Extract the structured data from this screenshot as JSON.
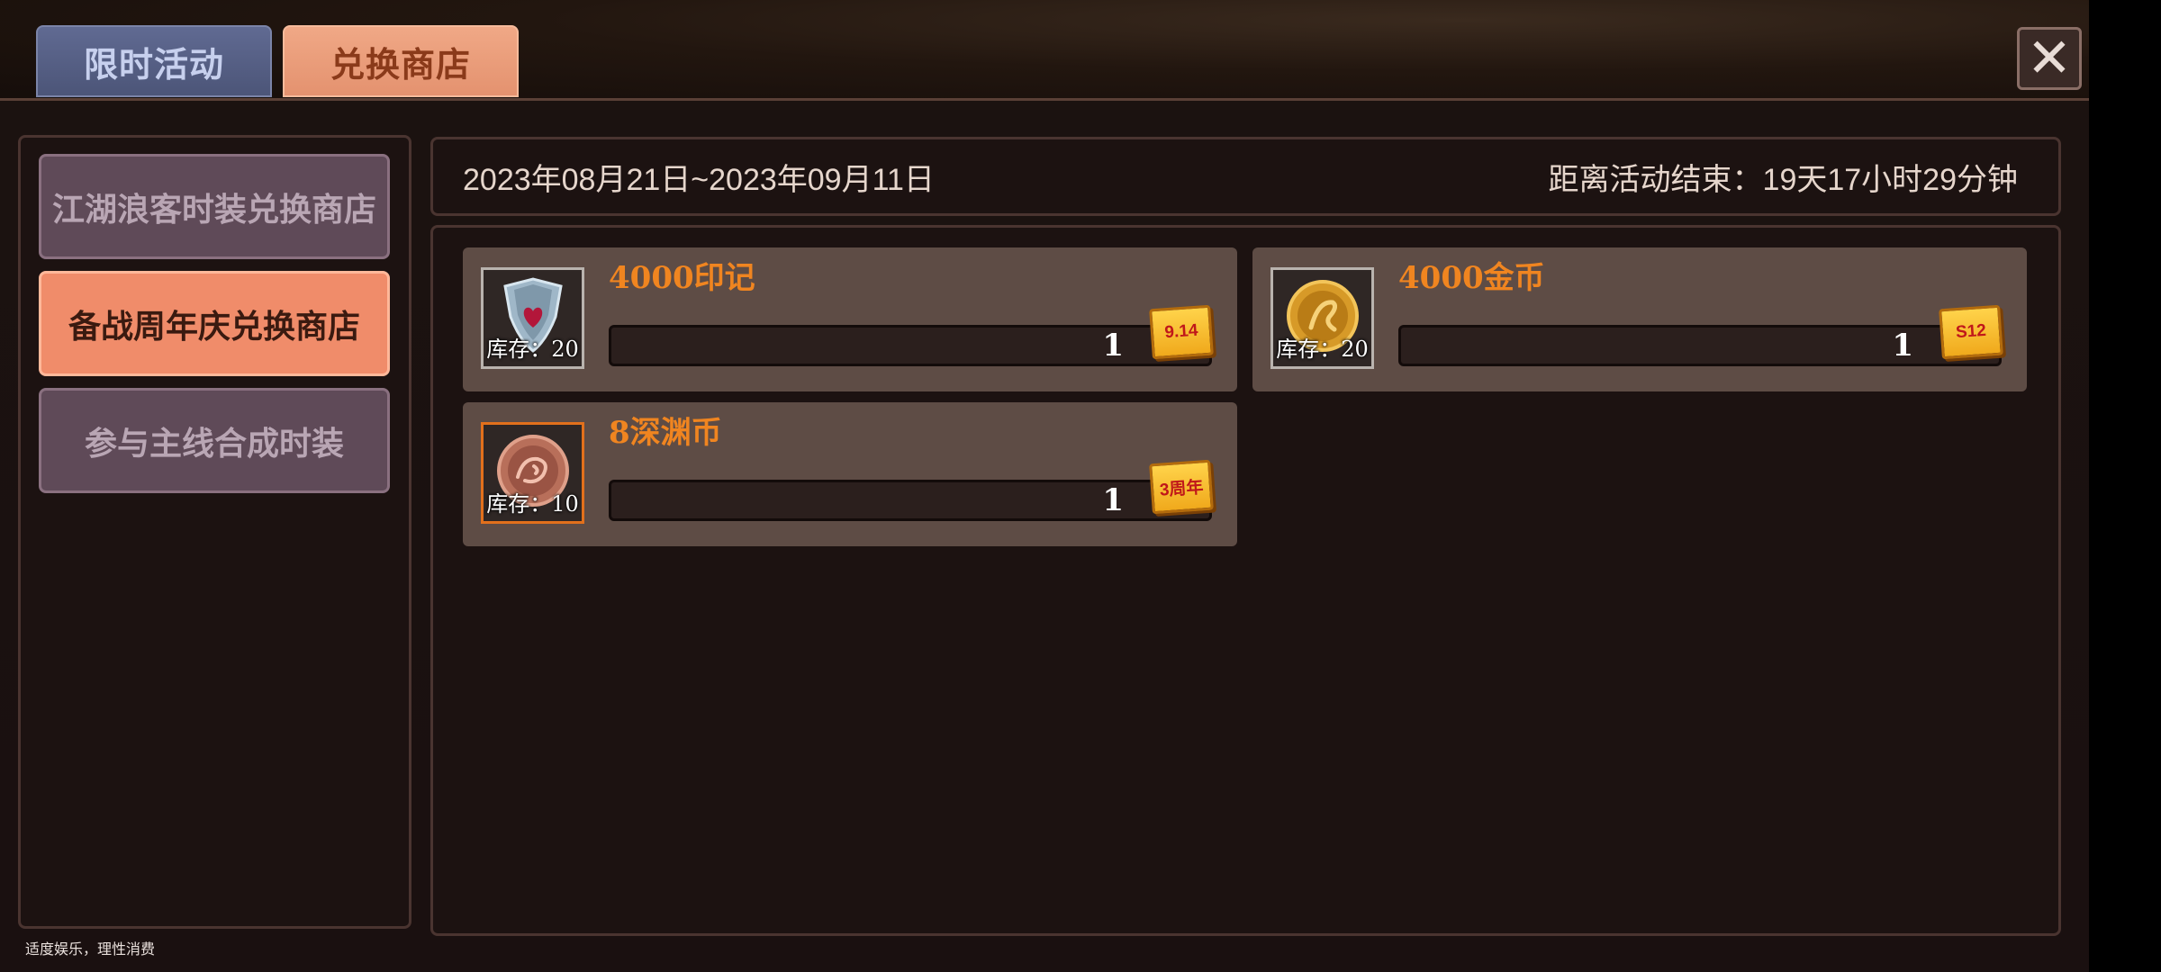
{
  "tabs": [
    {
      "label": "限时活动",
      "active": false
    },
    {
      "label": "兑换商店",
      "active": true
    }
  ],
  "close_icon": "close-icon",
  "sidebar": {
    "items": [
      {
        "label": "江湖浪客时装兑换商店",
        "active": false
      },
      {
        "label": "备战周年庆兑换商店",
        "active": true
      },
      {
        "label": "参与主线合成时装",
        "active": false
      }
    ]
  },
  "event": {
    "date_range": "2023年08月21日~2023年09月11日",
    "countdown": "距离活动结束：19天17小时29分钟"
  },
  "items": [
    {
      "title": "4000印记",
      "stock": "库存：20",
      "quantity": "1",
      "tag": "9.14",
      "icon": "shield-emblem-icon"
    },
    {
      "title": "4000金币",
      "stock": "库存：20",
      "quantity": "1",
      "tag": "S12",
      "icon": "gold-coin-icon"
    },
    {
      "title": "8深渊币",
      "stock": "库存：10",
      "quantity": "1",
      "tag": "3周年",
      "icon": "abyss-coin-icon"
    }
  ],
  "footer": {
    "note": "适度娱乐，理性消费"
  },
  "colors": {
    "active_tab": "#e4926f",
    "inactive_tab": "#4c5578",
    "title_orange": "#f08520",
    "active_side": "#f08c6a"
  }
}
